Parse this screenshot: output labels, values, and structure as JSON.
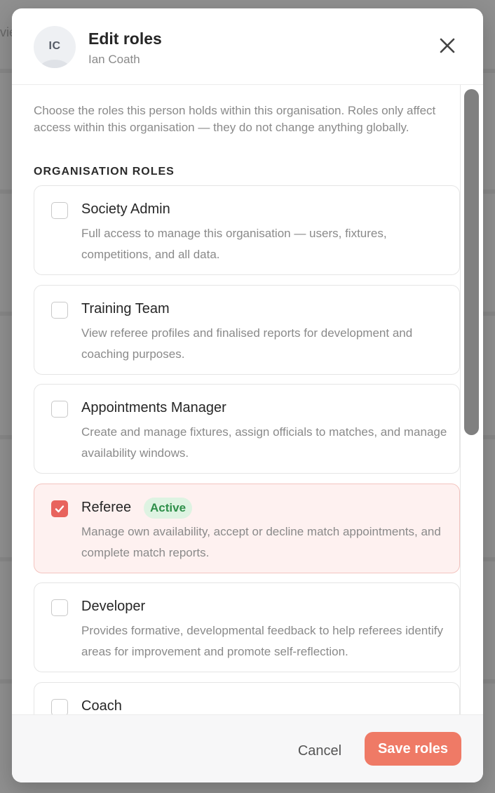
{
  "colors": {
    "accent": "#ef7a66",
    "checkbox_checked": "#e8635d",
    "active_card_bg": "#fef1f0",
    "badge_bg": "#def3e2",
    "badge_text": "#2f8f4a"
  },
  "backdrop": {
    "partial_text": "vie"
  },
  "header": {
    "avatar_initials": "IC",
    "title": "Edit roles",
    "subtitle": "Ian Coath",
    "close_icon": "close-icon"
  },
  "body": {
    "intro": "Choose the roles this person holds within this organisation. Roles only affect access within this organisation — they do not change anything globally.",
    "section_heading": "ORGANISATION ROLES",
    "roles": [
      {
        "name": "Society Admin",
        "description": "Full access to manage this organisation — users, fixtures, competitions, and all data.",
        "checked": false
      },
      {
        "name": "Training Team",
        "description": "View referee profiles and finalised reports for development and coaching purposes.",
        "checked": false
      },
      {
        "name": "Appointments Manager",
        "description": "Create and manage fixtures, assign officials to matches, and manage availability windows.",
        "checked": false
      },
      {
        "name": "Referee",
        "badge": "Active",
        "description": "Manage own availability, accept or decline match appointments, and complete match reports.",
        "checked": true
      },
      {
        "name": "Developer",
        "description": "Provides formative, developmental feedback to help referees identify areas for improvement and promote self-reflection.",
        "checked": false
      },
      {
        "name": "Coach",
        "description": "",
        "checked": false
      }
    ]
  },
  "footer": {
    "cancel_label": "Cancel",
    "save_label": "Save roles"
  }
}
